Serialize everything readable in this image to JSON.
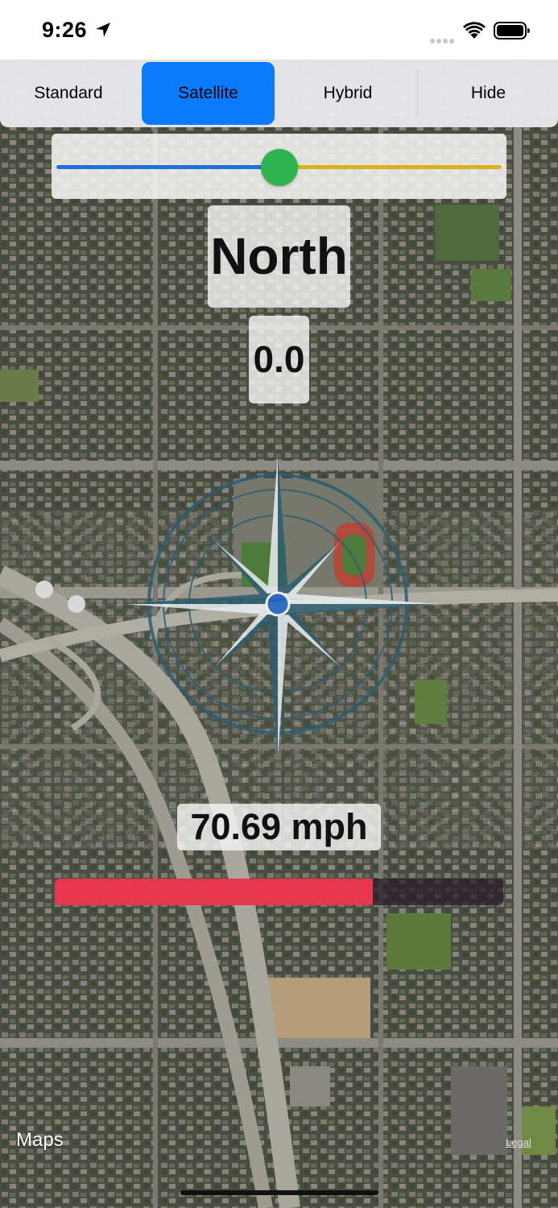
{
  "status_bar": {
    "time": "9:26"
  },
  "map_types": {
    "options": [
      "Standard",
      "Satellite",
      "Hybrid",
      "Hide"
    ],
    "selected": "Satellite"
  },
  "slider": {
    "value": 0.5
  },
  "heading": {
    "direction": "North",
    "degrees": "0.0"
  },
  "speed": {
    "label": "70.69 mph",
    "fraction": 0.71
  },
  "map_footer": {
    "logo_text": "Maps",
    "legal_label": "Legal"
  },
  "colors": {
    "selected_segment": "#0a7aff",
    "slider_min_track": "#1f6fe0",
    "slider_max_track": "#d7b21b",
    "slider_thumb": "#2fb34e",
    "speed_fill": "#e8364f"
  }
}
